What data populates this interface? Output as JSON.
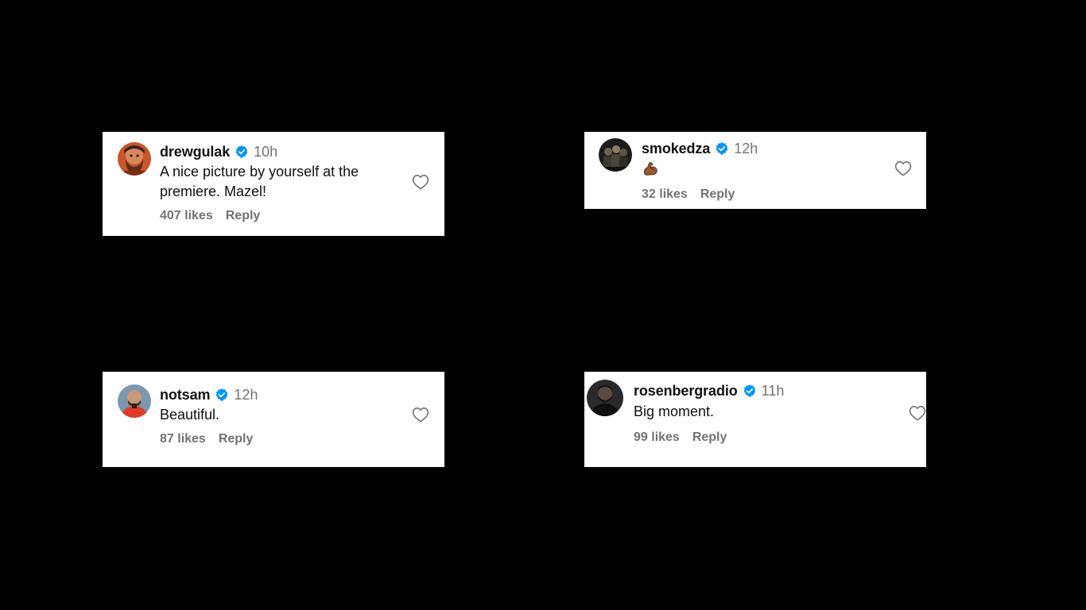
{
  "comments": [
    {
      "username": "drewgulak",
      "time": "10h",
      "text_line1": "A nice picture by yourself at the",
      "text_line2": "premiere. Mazel!",
      "likes": "407 likes",
      "reply": "Reply",
      "avatar": "bearded-man-photo",
      "verified": true
    },
    {
      "username": "smokedza",
      "time": "12h",
      "text_emoji": "flexed-biceps-emoji",
      "likes": "32 likes",
      "reply": "Reply",
      "avatar": "group-photo-dark",
      "verified": true
    },
    {
      "username": "notsam",
      "time": "12h",
      "text": "Beautiful.",
      "likes": "87 likes",
      "reply": "Reply",
      "avatar": "man-red-shirt-photo",
      "verified": true
    },
    {
      "username": "rosenbergradio",
      "time": "11h",
      "text": "Big moment.",
      "likes": "99 likes",
      "reply": "Reply",
      "avatar": "man-dark-photo",
      "verified": true
    }
  ],
  "colors": {
    "background": "#000000",
    "card": "#ffffff",
    "text": "#111111",
    "muted": "#737373",
    "verified": "#0095f6"
  },
  "icons": {
    "like": "heart-outline-icon",
    "verified": "verified-badge-icon"
  }
}
